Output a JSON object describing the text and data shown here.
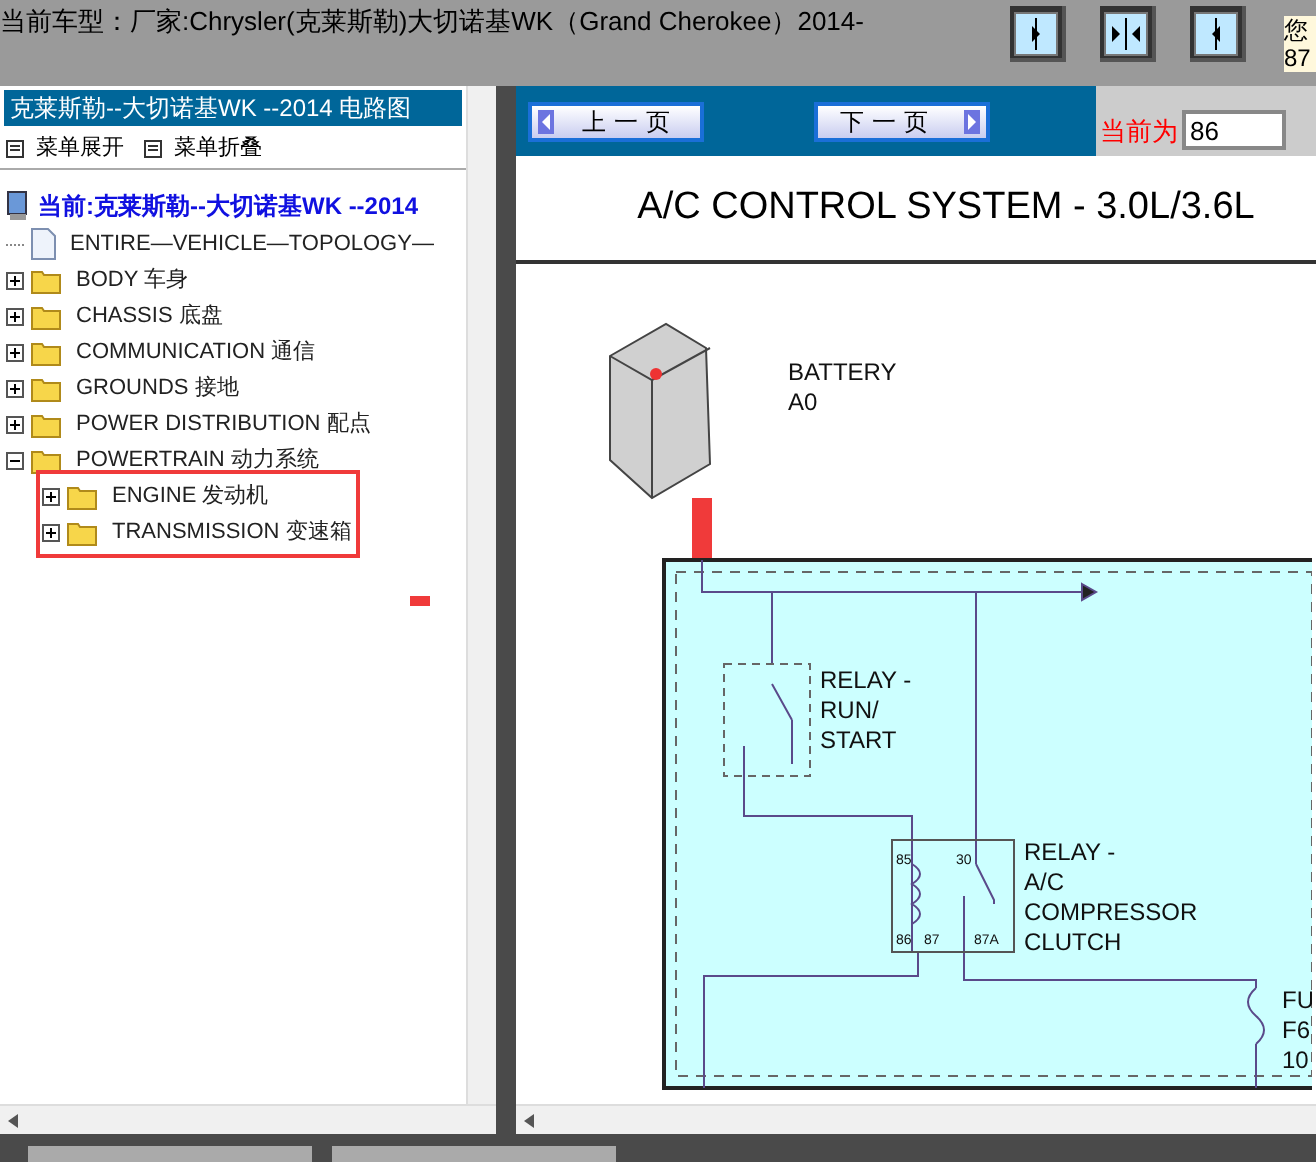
{
  "header": {
    "title": "当前车型：厂家:Chrysler(克莱斯勒)大切诺基WK（Grand Cherokee）2014-",
    "side_texts": [
      "您",
      "87"
    ]
  },
  "sidebar": {
    "title": "克莱斯勒--大切诺基WK --2014 电路图",
    "menu_buttons": [
      "菜单展开",
      "菜单折叠"
    ],
    "tree": {
      "label": "当前:克莱斯勒--大切诺基WK --2014",
      "children": [
        {
          "kind": "doc",
          "label": "ENTIRE—VEHICLE—TOPOLOGY—"
        },
        {
          "kind": "folder",
          "label": "BODY 车身",
          "expanded": false
        },
        {
          "kind": "folder",
          "label": "CHASSIS 底盘",
          "expanded": false
        },
        {
          "kind": "folder",
          "label": "COMMUNICATION 通信",
          "expanded": false
        },
        {
          "kind": "folder",
          "label": "GROUNDS 接地",
          "expanded": false
        },
        {
          "kind": "folder",
          "label": "POWER DISTRIBUTION 配点",
          "expanded": false
        },
        {
          "kind": "folder",
          "label": "POWERTRAIN 动力系统",
          "expanded": true,
          "children": [
            {
              "kind": "folder",
              "label": "ENGINE 发动机",
              "expanded": false
            },
            {
              "kind": "folder",
              "label": "TRANSMISSION 变速箱",
              "expanded": false
            }
          ]
        }
      ]
    }
  },
  "viewer": {
    "prev_button": "上一页",
    "next_button": "下一页",
    "page_label": "当前为",
    "page_value": "86",
    "diagram": {
      "title": "A/C CONTROL SYSTEM - 3.0L/3.6L",
      "battery": [
        "BATTERY",
        "A0"
      ],
      "relay_run": [
        "RELAY -",
        "RUN/",
        "START"
      ],
      "relay_ac": [
        "RELAY -",
        "A/C",
        "COMPRESSOR",
        "CLUTCH"
      ],
      "pins": [
        "85",
        "30",
        "86",
        "87",
        "87A"
      ],
      "fuse": [
        "FU",
        "F6",
        "10"
      ]
    }
  }
}
